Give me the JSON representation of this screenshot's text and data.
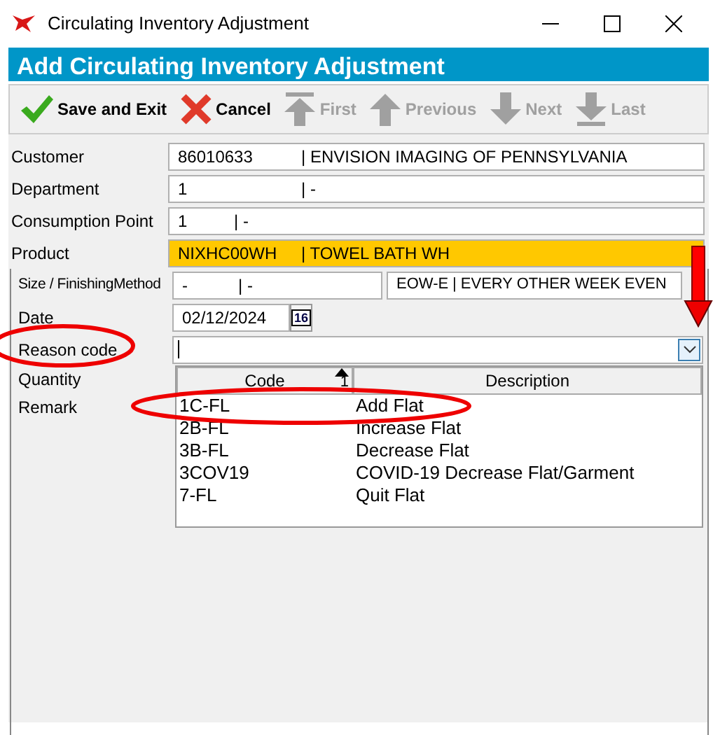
{
  "window": {
    "title": "Circulating Inventory Adjustment"
  },
  "header": "Add Circulating Inventory Adjustment",
  "toolbar": [
    {
      "kind": "check",
      "label": "Save and Exit",
      "disabled": false
    },
    {
      "kind": "cross",
      "label": "Cancel",
      "disabled": false
    },
    {
      "kind": "first",
      "label": "First",
      "disabled": true
    },
    {
      "kind": "up",
      "label": "Previous",
      "disabled": true
    },
    {
      "kind": "down",
      "label": "Next",
      "disabled": true
    },
    {
      "kind": "last",
      "label": "Last",
      "disabled": true
    }
  ],
  "top_fields": [
    {
      "label": "Customer",
      "value": "86010633",
      "detail": "| ENVISION IMAGING OF PENNSYLVANIA",
      "highlighted": false
    },
    {
      "label": "Department",
      "value": "1",
      "detail": "| -",
      "highlighted": false
    },
    {
      "label": "Consumption Point",
      "value": "1",
      "detail": "| -",
      "highlighted": false
    },
    {
      "label": "Product",
      "value": "NIXHC00WH",
      "detail": "| TOWEL BATH WH",
      "highlighted": true
    }
  ],
  "size_row": {
    "label": "Size / FinishingMethod",
    "size": "-",
    "size_detail": "| -",
    "method": "EOW-E",
    "method_detail": "| EVERY OTHER WEEK EVEN"
  },
  "date": {
    "label": "Date",
    "value": "02/12/2024",
    "calendar": "16"
  },
  "reason_code": {
    "label": "Reason code",
    "expanded": true
  },
  "other_labels": [
    "Quantity",
    "Remark"
  ],
  "dropdown": {
    "columns": [
      {
        "label": "Code",
        "sort": "1"
      },
      {
        "label": "Description"
      }
    ],
    "rows": [
      {
        "code": "1C-FL",
        "description": "Add Flat"
      },
      {
        "code": "2B-FL",
        "description": "Increase Flat"
      },
      {
        "code": "3B-FL",
        "description": "Decrease Flat"
      },
      {
        "code": "3COV19",
        "description": "COVID-19 Decrease Flat/Garment"
      },
      {
        "code": "7-FL",
        "description": "Quit Flat"
      }
    ]
  }
}
